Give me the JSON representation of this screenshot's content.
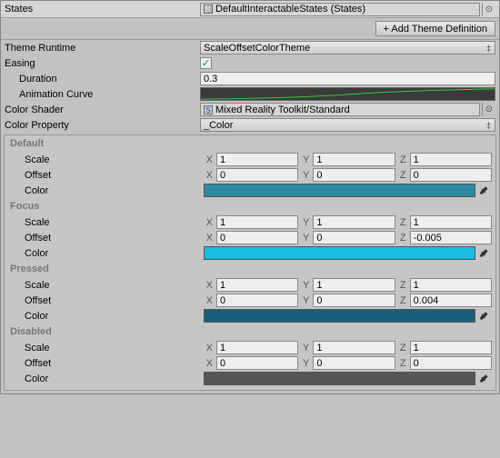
{
  "states": {
    "label": "States",
    "value": "DefaultInteractableStates (States)"
  },
  "add_theme_btn": "+ Add Theme Definition",
  "theme_runtime": {
    "label": "Theme Runtime",
    "value": "ScaleOffsetColorTheme"
  },
  "easing": {
    "label": "Easing",
    "checked": "✓",
    "duration_label": "Duration",
    "duration_value": "0.3",
    "curve_label": "Animation Curve"
  },
  "color_shader": {
    "label": "Color Shader",
    "value": "Mixed Reality Toolkit/Standard"
  },
  "color_property": {
    "label": "Color Property",
    "value": "_Color"
  },
  "axis": {
    "x": "X",
    "y": "Y",
    "z": "Z"
  },
  "props": {
    "scale": "Scale",
    "offset": "Offset",
    "color": "Color"
  },
  "states_list": [
    {
      "name": "Default",
      "scale": {
        "x": "1",
        "y": "1",
        "z": "1"
      },
      "offset": {
        "x": "0",
        "y": "0",
        "z": "0"
      },
      "color": "#2d8aa0"
    },
    {
      "name": "Focus",
      "scale": {
        "x": "1",
        "y": "1",
        "z": "1"
      },
      "offset": {
        "x": "0",
        "y": "0",
        "z": "-0.005"
      },
      "color": "#17bde0"
    },
    {
      "name": "Pressed",
      "scale": {
        "x": "1",
        "y": "1",
        "z": "1"
      },
      "offset": {
        "x": "0",
        "y": "0",
        "z": "0.004"
      },
      "color": "#1a5f7a"
    },
    {
      "name": "Disabled",
      "scale": {
        "x": "1",
        "y": "1",
        "z": "1"
      },
      "offset": {
        "x": "0",
        "y": "0",
        "z": "0"
      },
      "color": "#555555"
    }
  ]
}
